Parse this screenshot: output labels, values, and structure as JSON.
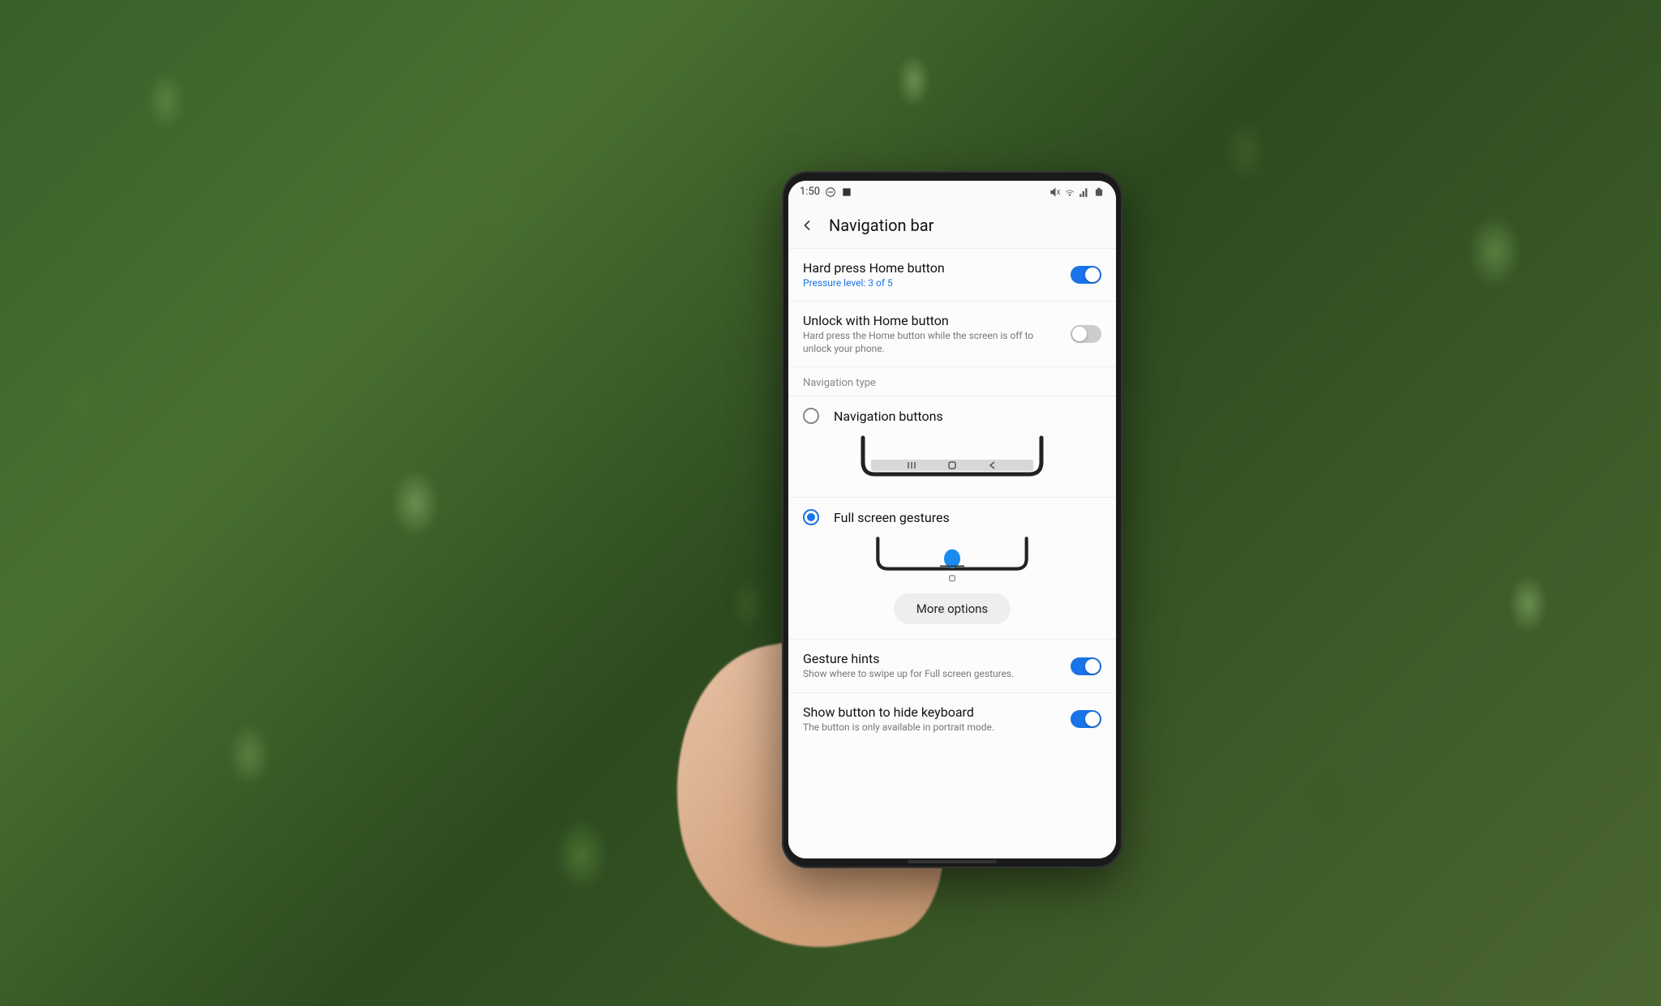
{
  "status_bar": {
    "time": "1:50",
    "icons_left": [
      "circle-slash",
      "square"
    ],
    "icons_right": [
      "mute",
      "wifi",
      "signal",
      "battery"
    ]
  },
  "header": {
    "title": "Navigation bar"
  },
  "settings": {
    "hard_press": {
      "title": "Hard press Home button",
      "subtitle": "Pressure level: 3 of 5",
      "enabled": true
    },
    "unlock": {
      "title": "Unlock with Home button",
      "subtitle": "Hard press the Home button while the screen is off to unlock your phone.",
      "enabled": false
    }
  },
  "nav_type": {
    "section_label": "Navigation type",
    "options": [
      {
        "label": "Navigation buttons",
        "selected": false
      },
      {
        "label": "Full screen gestures",
        "selected": true
      }
    ],
    "more_options": "More options"
  },
  "bottom_settings": {
    "gesture_hints": {
      "title": "Gesture hints",
      "subtitle": "Show where to swipe up for Full screen gestures.",
      "enabled": true
    },
    "hide_keyboard": {
      "title": "Show button to hide keyboard",
      "subtitle": "The button is only available in portrait mode.",
      "enabled": true
    }
  }
}
